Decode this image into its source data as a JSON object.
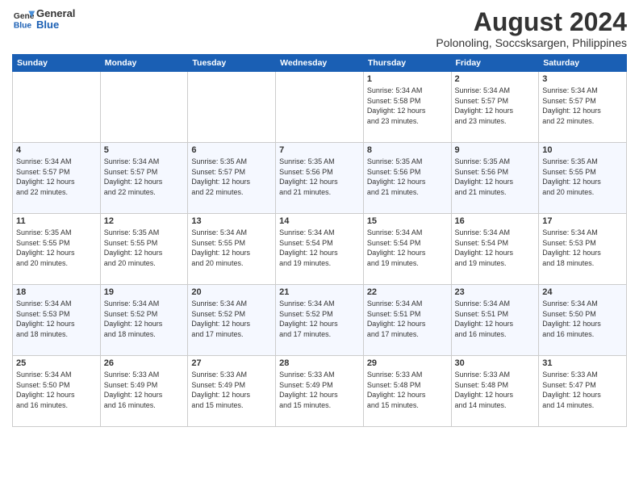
{
  "logo": {
    "general": "General",
    "blue": "Blue"
  },
  "header": {
    "month_year": "August 2024",
    "location": "Polonoling, Soccsksargen, Philippines"
  },
  "days_of_week": [
    "Sunday",
    "Monday",
    "Tuesday",
    "Wednesday",
    "Thursday",
    "Friday",
    "Saturday"
  ],
  "weeks": [
    [
      {
        "day": "",
        "info": ""
      },
      {
        "day": "",
        "info": ""
      },
      {
        "day": "",
        "info": ""
      },
      {
        "day": "",
        "info": ""
      },
      {
        "day": "1",
        "info": "Sunrise: 5:34 AM\nSunset: 5:58 PM\nDaylight: 12 hours\nand 23 minutes."
      },
      {
        "day": "2",
        "info": "Sunrise: 5:34 AM\nSunset: 5:57 PM\nDaylight: 12 hours\nand 23 minutes."
      },
      {
        "day": "3",
        "info": "Sunrise: 5:34 AM\nSunset: 5:57 PM\nDaylight: 12 hours\nand 22 minutes."
      }
    ],
    [
      {
        "day": "4",
        "info": "Sunrise: 5:34 AM\nSunset: 5:57 PM\nDaylight: 12 hours\nand 22 minutes."
      },
      {
        "day": "5",
        "info": "Sunrise: 5:34 AM\nSunset: 5:57 PM\nDaylight: 12 hours\nand 22 minutes."
      },
      {
        "day": "6",
        "info": "Sunrise: 5:35 AM\nSunset: 5:57 PM\nDaylight: 12 hours\nand 22 minutes."
      },
      {
        "day": "7",
        "info": "Sunrise: 5:35 AM\nSunset: 5:56 PM\nDaylight: 12 hours\nand 21 minutes."
      },
      {
        "day": "8",
        "info": "Sunrise: 5:35 AM\nSunset: 5:56 PM\nDaylight: 12 hours\nand 21 minutes."
      },
      {
        "day": "9",
        "info": "Sunrise: 5:35 AM\nSunset: 5:56 PM\nDaylight: 12 hours\nand 21 minutes."
      },
      {
        "day": "10",
        "info": "Sunrise: 5:35 AM\nSunset: 5:55 PM\nDaylight: 12 hours\nand 20 minutes."
      }
    ],
    [
      {
        "day": "11",
        "info": "Sunrise: 5:35 AM\nSunset: 5:55 PM\nDaylight: 12 hours\nand 20 minutes."
      },
      {
        "day": "12",
        "info": "Sunrise: 5:35 AM\nSunset: 5:55 PM\nDaylight: 12 hours\nand 20 minutes."
      },
      {
        "day": "13",
        "info": "Sunrise: 5:34 AM\nSunset: 5:55 PM\nDaylight: 12 hours\nand 20 minutes."
      },
      {
        "day": "14",
        "info": "Sunrise: 5:34 AM\nSunset: 5:54 PM\nDaylight: 12 hours\nand 19 minutes."
      },
      {
        "day": "15",
        "info": "Sunrise: 5:34 AM\nSunset: 5:54 PM\nDaylight: 12 hours\nand 19 minutes."
      },
      {
        "day": "16",
        "info": "Sunrise: 5:34 AM\nSunset: 5:54 PM\nDaylight: 12 hours\nand 19 minutes."
      },
      {
        "day": "17",
        "info": "Sunrise: 5:34 AM\nSunset: 5:53 PM\nDaylight: 12 hours\nand 18 minutes."
      }
    ],
    [
      {
        "day": "18",
        "info": "Sunrise: 5:34 AM\nSunset: 5:53 PM\nDaylight: 12 hours\nand 18 minutes."
      },
      {
        "day": "19",
        "info": "Sunrise: 5:34 AM\nSunset: 5:52 PM\nDaylight: 12 hours\nand 18 minutes."
      },
      {
        "day": "20",
        "info": "Sunrise: 5:34 AM\nSunset: 5:52 PM\nDaylight: 12 hours\nand 17 minutes."
      },
      {
        "day": "21",
        "info": "Sunrise: 5:34 AM\nSunset: 5:52 PM\nDaylight: 12 hours\nand 17 minutes."
      },
      {
        "day": "22",
        "info": "Sunrise: 5:34 AM\nSunset: 5:51 PM\nDaylight: 12 hours\nand 17 minutes."
      },
      {
        "day": "23",
        "info": "Sunrise: 5:34 AM\nSunset: 5:51 PM\nDaylight: 12 hours\nand 16 minutes."
      },
      {
        "day": "24",
        "info": "Sunrise: 5:34 AM\nSunset: 5:50 PM\nDaylight: 12 hours\nand 16 minutes."
      }
    ],
    [
      {
        "day": "25",
        "info": "Sunrise: 5:34 AM\nSunset: 5:50 PM\nDaylight: 12 hours\nand 16 minutes."
      },
      {
        "day": "26",
        "info": "Sunrise: 5:33 AM\nSunset: 5:49 PM\nDaylight: 12 hours\nand 16 minutes."
      },
      {
        "day": "27",
        "info": "Sunrise: 5:33 AM\nSunset: 5:49 PM\nDaylight: 12 hours\nand 15 minutes."
      },
      {
        "day": "28",
        "info": "Sunrise: 5:33 AM\nSunset: 5:49 PM\nDaylight: 12 hours\nand 15 minutes."
      },
      {
        "day": "29",
        "info": "Sunrise: 5:33 AM\nSunset: 5:48 PM\nDaylight: 12 hours\nand 15 minutes."
      },
      {
        "day": "30",
        "info": "Sunrise: 5:33 AM\nSunset: 5:48 PM\nDaylight: 12 hours\nand 14 minutes."
      },
      {
        "day": "31",
        "info": "Sunrise: 5:33 AM\nSunset: 5:47 PM\nDaylight: 12 hours\nand 14 minutes."
      }
    ]
  ]
}
